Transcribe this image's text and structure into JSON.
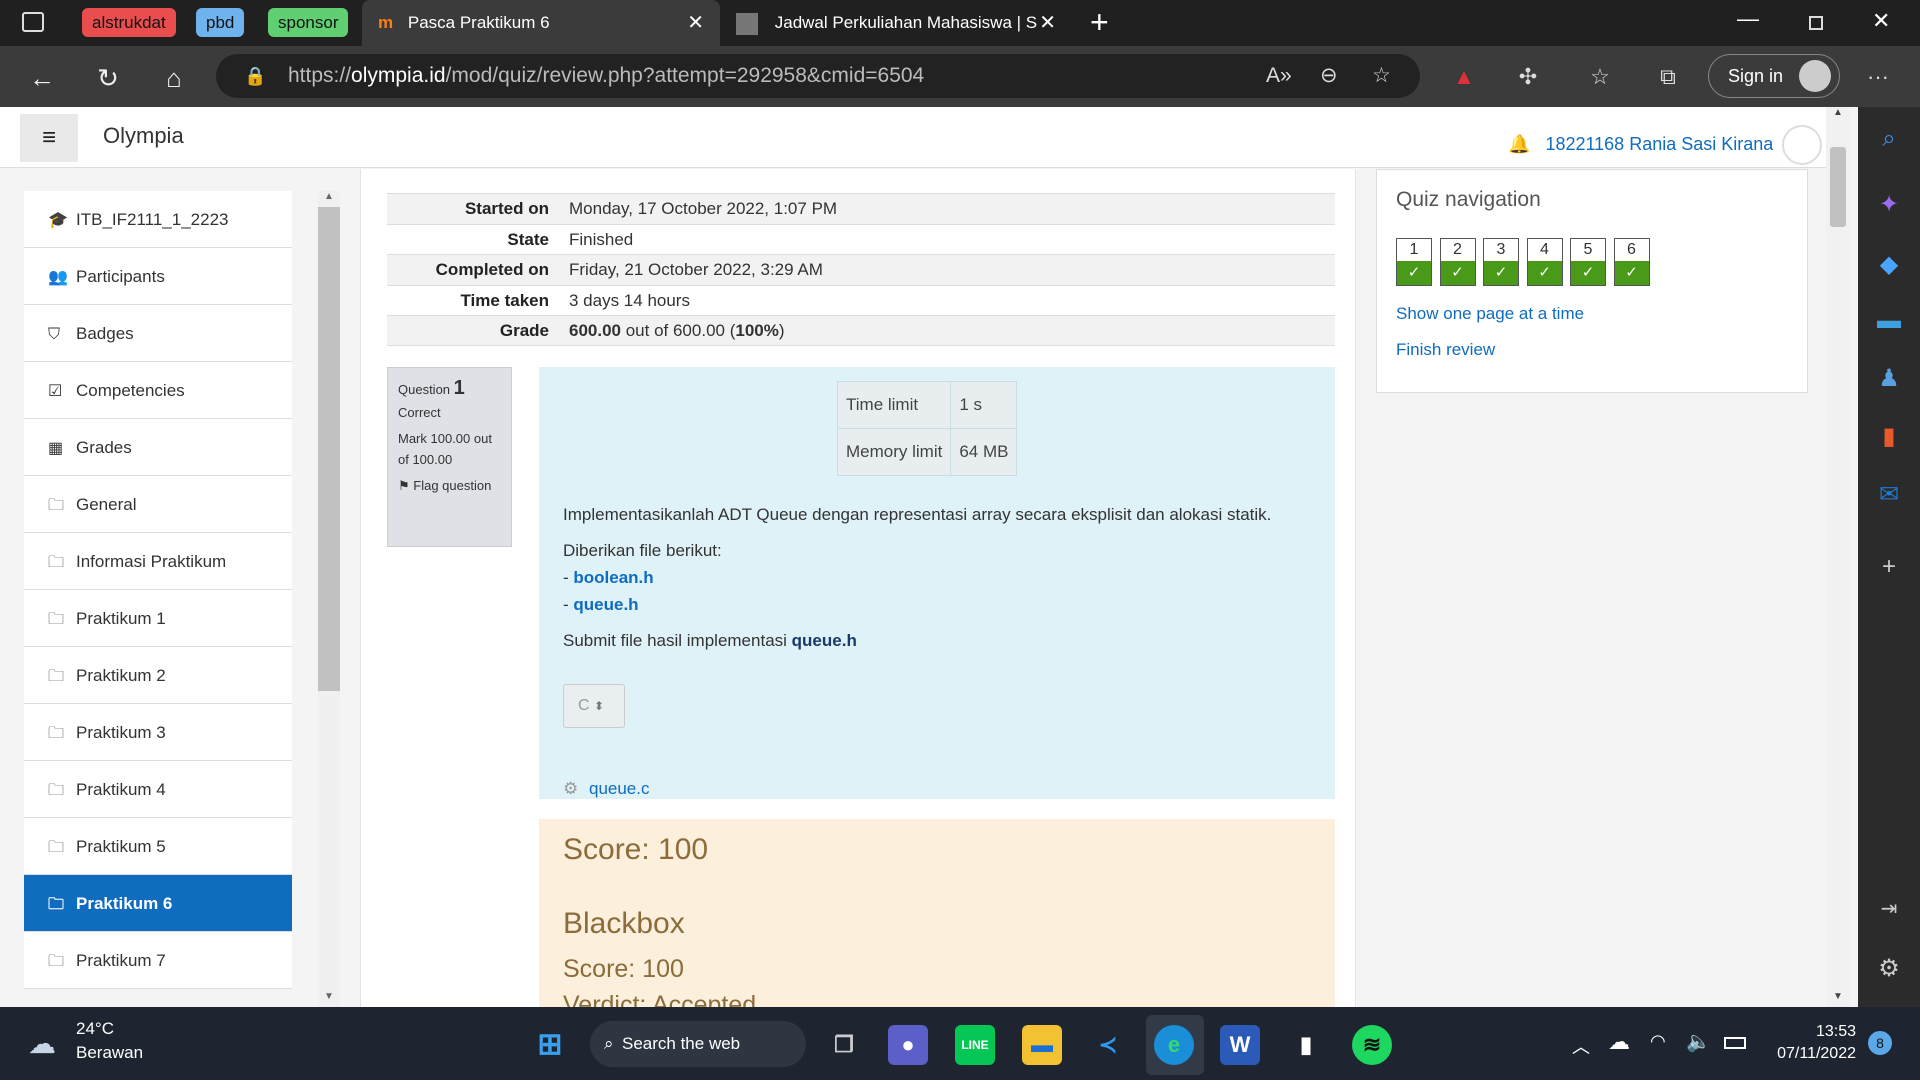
{
  "tab_groups": [
    {
      "label": "alstrukdat",
      "color": "#e94d4d"
    },
    {
      "label": "pbd",
      "color": "#6fb3ee"
    },
    {
      "label": "sponsor",
      "color": "#5fcf72"
    }
  ],
  "tabs": [
    {
      "title": "Pasca Praktikum 6",
      "active": true
    },
    {
      "title": "Jadwal Perkuliahan Mahasiswa | S",
      "active": false
    }
  ],
  "address": {
    "scheme": "https://",
    "domain": "olympia.id",
    "path": "/mod/quiz/review.php?attempt=292958&cmid=6504"
  },
  "browser": {
    "sign_in": "Sign in"
  },
  "site": {
    "name": "Olympia",
    "user": "18221168 Rania Sasi Kirana"
  },
  "sidebar": {
    "items": [
      {
        "label": "ITB_IF2111_1_2223",
        "icon": "graduation-cap-icon",
        "glyph": "🎓"
      },
      {
        "label": "Participants",
        "icon": "users-icon",
        "glyph": "👥"
      },
      {
        "label": "Badges",
        "icon": "shield-icon",
        "glyph": "⛉"
      },
      {
        "label": "Competencies",
        "icon": "checkbox-icon",
        "glyph": "☑"
      },
      {
        "label": "Grades",
        "icon": "table-icon",
        "glyph": "▦"
      },
      {
        "label": "General",
        "icon": "folder-icon",
        "glyph": "🗀"
      },
      {
        "label": "Informasi Praktikum",
        "icon": "folder-icon",
        "glyph": "🗀"
      },
      {
        "label": "Praktikum 1",
        "icon": "folder-icon",
        "glyph": "🗀"
      },
      {
        "label": "Praktikum 2",
        "icon": "folder-icon",
        "glyph": "🗀"
      },
      {
        "label": "Praktikum 3",
        "icon": "folder-icon",
        "glyph": "🗀"
      },
      {
        "label": "Praktikum 4",
        "icon": "folder-icon",
        "glyph": "🗀"
      },
      {
        "label": "Praktikum 5",
        "icon": "folder-icon",
        "glyph": "🗀"
      },
      {
        "label": "Praktikum 6",
        "icon": "folder-icon",
        "glyph": "🗀",
        "active": true
      },
      {
        "label": "Praktikum 7",
        "icon": "folder-icon",
        "glyph": "🗀"
      }
    ]
  },
  "summary": {
    "started_label": "Started on",
    "started": "Monday, 17 October 2022, 1:07 PM",
    "state_label": "State",
    "state": "Finished",
    "completed_label": "Completed on",
    "completed": "Friday, 21 October 2022, 3:29 AM",
    "time_label": "Time taken",
    "time": "3 days 14 hours",
    "grade_label": "Grade",
    "grade_bold": "600.00",
    "grade_mid": " out of 600.00 (",
    "grade_pct": "100%",
    "grade_end": ")"
  },
  "question": {
    "label": "Question",
    "number": "1",
    "status": "Correct",
    "mark": "Mark 100.00 out of 100.00",
    "flag": "Flag question",
    "limits": [
      {
        "name": "Time limit",
        "value": "1 s"
      },
      {
        "name": "Memory limit",
        "value": "64 MB"
      }
    ],
    "text": "Implementasikanlah ADT Queue dengan representasi array secara eksplisit dan alokasi statik.",
    "given": "Diberikan file berikut:",
    "files": [
      "boolean.h",
      "queue.h"
    ],
    "submit_pre": "Submit file hasil implementasi ",
    "submit_file": "queue.h",
    "language": "C",
    "attachment": "queue.c"
  },
  "feedback": {
    "score": "Score: 100",
    "blackbox": "Blackbox",
    "blackbox_score": "Score: 100",
    "verdict": "Verdict: Accepted"
  },
  "quiz_nav": {
    "title": "Quiz navigation",
    "questions": [
      "1",
      "2",
      "3",
      "4",
      "5",
      "6"
    ],
    "show_one_page": "Show one page at a time",
    "finish_review": "Finish review"
  },
  "taskbar": {
    "weather_temp": "24°C",
    "weather_desc": "Berawan",
    "search": "Search the web",
    "time": "13:53",
    "date": "07/11/2022",
    "notifications": "8"
  }
}
